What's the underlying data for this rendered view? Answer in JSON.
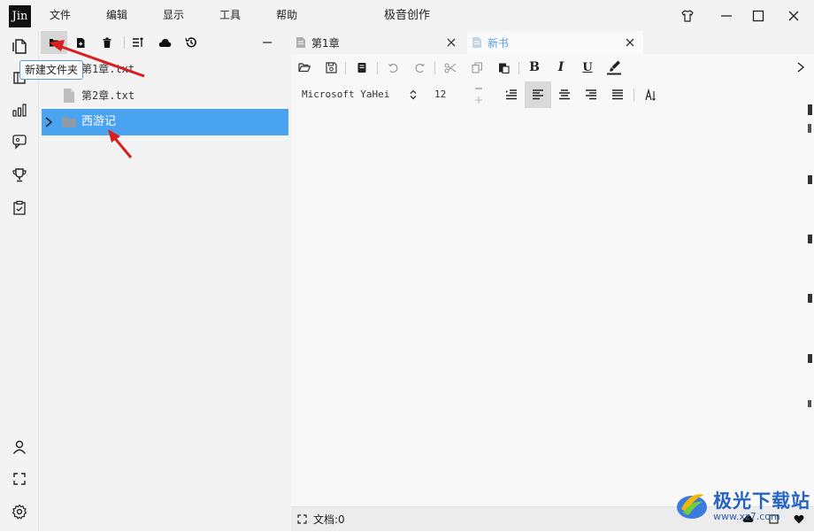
{
  "app": {
    "logo_text": "Jin",
    "title": "极音创作",
    "menu": [
      "文件",
      "编辑",
      "显示",
      "工具",
      "帮助"
    ]
  },
  "file_panel": {
    "tooltip": "新建文件夹",
    "tree": [
      {
        "label": "第1章.txt",
        "type": "file",
        "selected": false
      },
      {
        "label": "第2章.txt",
        "type": "file",
        "selected": false
      },
      {
        "label": "西游记",
        "type": "folder",
        "selected": true
      }
    ]
  },
  "editor": {
    "tabs": [
      {
        "label": "第1章",
        "active": false
      },
      {
        "label": "新书",
        "active": true
      }
    ],
    "toolbar": {
      "bold": "B",
      "italic": "I",
      "underline": "U",
      "font_name": "Microsoft YaHei",
      "font_size": "12",
      "alignment": "left"
    },
    "status": "文档:0"
  },
  "watermark": {
    "name": "极光下载站",
    "url": "www.xz7.com"
  },
  "colors": {
    "accent": "#4aa3f0",
    "active_tab_text": "#5aa0e6",
    "annotation_arrow": "#d81e1e",
    "watermark_blue": "#2563c4"
  }
}
